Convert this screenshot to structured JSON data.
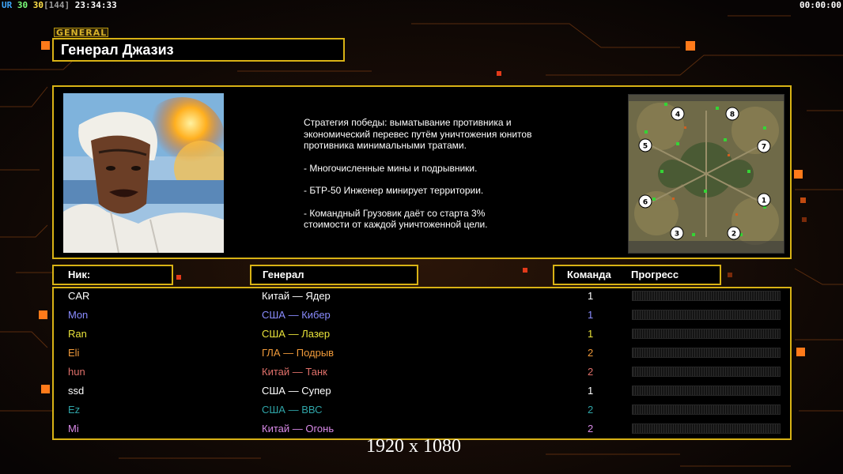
{
  "hud": {
    "prefix": "UR",
    "val1": "30",
    "val2": "30",
    "val3": "[144]",
    "clock": "23:34:33",
    "timer": "00:00:00"
  },
  "general": {
    "tag": "GENERAL",
    "name": "Генерал Джазиз",
    "description": [
      "Стратегия победы: выматывание противника и\n экономический перевес путём уничтожения юнитов\n противника минимальными тратами.",
      "- Многочисленные мины и подрывники.",
      "- БТР-50 Инженер минирует территории.",
      "- Командный Грузовик даёт со старта 3%\n стоимости от каждой уничтоженной цели."
    ]
  },
  "minimap": {
    "spawn_labels": [
      "4",
      "8",
      "5",
      "7",
      "6",
      "1",
      "3",
      "2"
    ]
  },
  "table": {
    "headers": {
      "nick": "Ник:",
      "general": "Генерал",
      "team": "Команда",
      "progress": "Прогресс"
    },
    "rows": [
      {
        "nick": "CAR",
        "general": "Китай — Ядер",
        "team": "1",
        "color": "#ffffff",
        "progress": 0
      },
      {
        "nick": "Mon",
        "general": "США — Кибер",
        "team": "1",
        "color": "#8a8cff",
        "progress": 0
      },
      {
        "nick": "Ran",
        "general": "США — Лазер",
        "team": "1",
        "color": "#e8e23a",
        "progress": 0
      },
      {
        "nick": "Eli",
        "general": "ГЛА — Подрыв",
        "team": "2",
        "color": "#f09a3a",
        "progress": 0
      },
      {
        "nick": "hun",
        "general": "Китай — Танк",
        "team": "2",
        "color": "#e0706a",
        "progress": 0
      },
      {
        "nick": "ssd",
        "general": "США — Супер",
        "team": "1",
        "color": "#ffffff",
        "progress": 0
      },
      {
        "nick": "Ez",
        "general": "США — ВВС",
        "team": "2",
        "color": "#2fa5a8",
        "progress": 0
      },
      {
        "nick": "Mi",
        "general": "Китай — Огонь",
        "team": "2",
        "color": "#d98ae8",
        "progress": 0
      }
    ]
  },
  "resolution": "1920 x 1080",
  "colors": {
    "accent": "#d8b215",
    "orange_glow": "#ff7a1a"
  }
}
